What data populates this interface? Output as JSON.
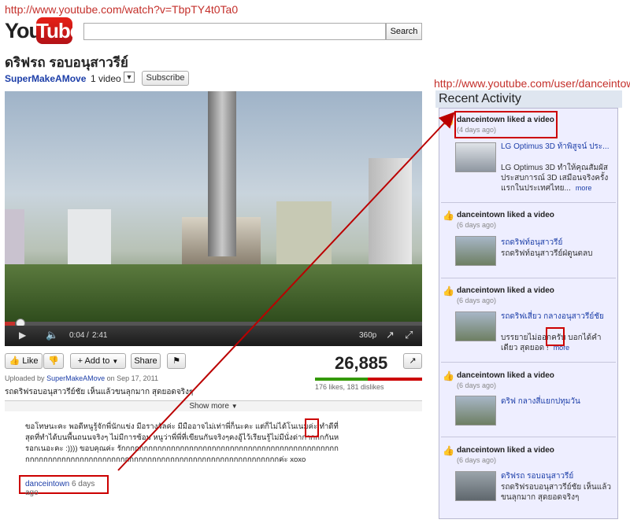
{
  "annotations": {
    "video_url": "http://www.youtube.com/watch?v=TbpTY4t0Ta0",
    "user_url": "http://www.youtube.com/user/danceintown"
  },
  "header": {
    "logo_you": "You",
    "logo_tube": "Tube",
    "search_placeholder": "",
    "search_button": "Search"
  },
  "video": {
    "title": "ดริฟรถ รอบอนุสาวรีย์",
    "channel": "SuperMakeAMove",
    "video_count": "1 video",
    "subscribe": "Subscribe",
    "time_current": "0:04",
    "time_total": "2:41",
    "quality": "360p",
    "progress_fraction": 0.025,
    "like": "Like",
    "add_to": "Add to",
    "share": "Share",
    "views": "26,885",
    "likes_text": "176 likes, 181 dislikes",
    "likes": 176,
    "dislikes": 181,
    "uploaded_prefix": "Uploaded by",
    "uploader": "SuperMakeAMove",
    "uploaded_date": "on Sep 17, 2011",
    "description": "รถดริฟรอบอนุสาวรีย์ชัย เห็นแล้วขนลุกมาก สุดยอดจริงๆ",
    "show_more": "Show more"
  },
  "comment": {
    "text": "ขอโทษนะคะ พอดีหนูรู้จักพี่นักแข่ง มีอรางวัลค่ะ มีมืออาจไม่เท่าพี่ก็นะคะ แต่ก็ไม่ได้โนเนมค่ะ ทำดีที่สุดที่ทำได้บนพื้นถนนจริงๆ ไม่มีการซ้อม หนูว่าพี่พี่ที่เขียนกันจริงๆคงอู้ไว้เรียนรู้ไม่มีนั่งด่ากากกกกันหรอกเนอะคะ :)))) ขอบคุณค่ะ รักกกกกกกกกกกกกกกกกกกกกกกกกกกกกกกกกกกกกกกกกกกกกกกกกกกกกกกกกกกกกกกกกกกกกกกกกกกกกกกกกกกกกกกกกกกกกกกกกกกกกกกกค่ะ xoxo",
    "author": "danceintown",
    "ago": "6 days ago"
  },
  "recent_activity": {
    "title": "Recent Activity",
    "items": [
      {
        "who": "danceintown liked a video",
        "when": "(4 days ago)",
        "video_title": "LG Optimus 3D ท้าพิสูจน์ ประ...",
        "video_desc": "LG Optimus 3D ทำให้คุณสัมผัสประสบการณ์ 3D เสมือนจริงครั้งแรกในประเทศไทย...",
        "more": "more"
      },
      {
        "who": "danceintown liked a video",
        "when": "(6 days ago)",
        "video_title": "รถดริฟท์อนุสาวรีย์",
        "video_desc": "รถดริฟท์อนุสาวรีย์ฝ่ดูนตลบ",
        "more": ""
      },
      {
        "who": "danceintown liked a video",
        "when": "(6 days ago)",
        "video_title": "รถดริฟเสี่ยว กลางอนุสาวรีย์ชัย",
        "video_desc": "บรรยายไม่ออกครับ บอกได้คำเดียว สุดยอด !",
        "more": "more"
      },
      {
        "who": "danceintown liked a video",
        "when": "(6 days ago)",
        "video_title": "ดริฟ กลางสี่แยกปทุมวัน",
        "video_desc": "",
        "more": ""
      },
      {
        "who": "danceintown liked a video",
        "when": "(6 days ago)",
        "video_title": "ดริฟรถ รอบอนุสาวรีย์",
        "video_desc": "รถดริฟรอบอนุสาวรีย์ชัย เห็นแล้วขนลุกมาก สุดยอดจริงๆ",
        "more": ""
      }
    ]
  },
  "colors": {
    "annotation_red": "#c4302b",
    "link_blue": "#1c3ea8",
    "like_green": "#339900",
    "dislike_red": "#cc0000"
  }
}
